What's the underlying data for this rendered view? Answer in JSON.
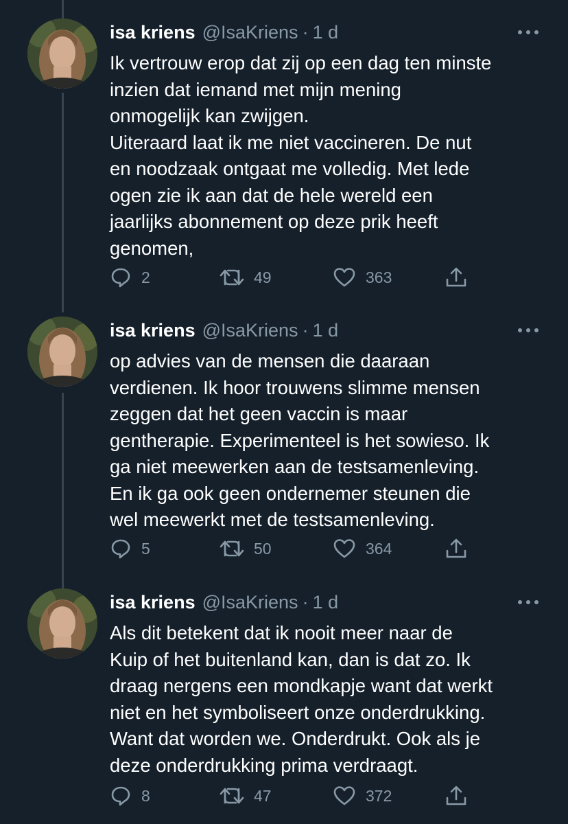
{
  "tweets": [
    {
      "name": "isa kriens",
      "handle": "@IsaKriens",
      "separator": "·",
      "time": "1 d",
      "lines": [
        "Ik vertrouw erop dat zij op een dag ten minste",
        "inzien dat iemand met mijn mening",
        "onmogelijk kan zwijgen.",
        "Uiteraard laat ik me niet vaccineren. De nut",
        "en noodzaak ontgaat me volledig. Met lede",
        "ogen zie ik aan dat de hele wereld een",
        "jaarlijks abonnement op deze prik heeft",
        "genomen,"
      ],
      "replies": "2",
      "retweets": "49",
      "likes": "363"
    },
    {
      "name": "isa kriens",
      "handle": "@IsaKriens",
      "separator": "·",
      "time": "1 d",
      "lines": [
        "op advies van de mensen die daaraan",
        "verdienen. Ik hoor trouwens slimme mensen",
        "zeggen dat het geen vaccin is maar",
        "gentherapie. Experimenteel is het sowieso. Ik",
        "ga niet meewerken aan de testsamenleving.",
        "En ik ga ook geen ondernemer steunen die",
        "wel meewerkt met de testsamenleving."
      ],
      "replies": "5",
      "retweets": "50",
      "likes": "364"
    },
    {
      "name": "isa kriens",
      "handle": "@IsaKriens",
      "separator": "·",
      "time": "1 d",
      "lines": [
        "Als dit betekent dat ik nooit meer naar de",
        "Kuip of het buitenland kan, dan is dat zo. Ik",
        "draag nergens een mondkapje want dat werkt",
        "niet en het symboliseert onze onderdrukking.",
        "Want dat worden we. Onderdrukt. Ook als je",
        "deze onderdrukking prima verdraagt."
      ],
      "replies": "8",
      "retweets": "47",
      "likes": "372"
    }
  ],
  "icons": {
    "reply": "reply-icon",
    "retweet": "retweet-icon",
    "like": "heart-icon",
    "share": "share-icon",
    "more": "more-options-icon",
    "avatar": "profile-photo"
  },
  "colors": {
    "background": "#15202b",
    "text": "#ffffff",
    "secondary": "#8899a6",
    "thread_line": "#38444d"
  }
}
